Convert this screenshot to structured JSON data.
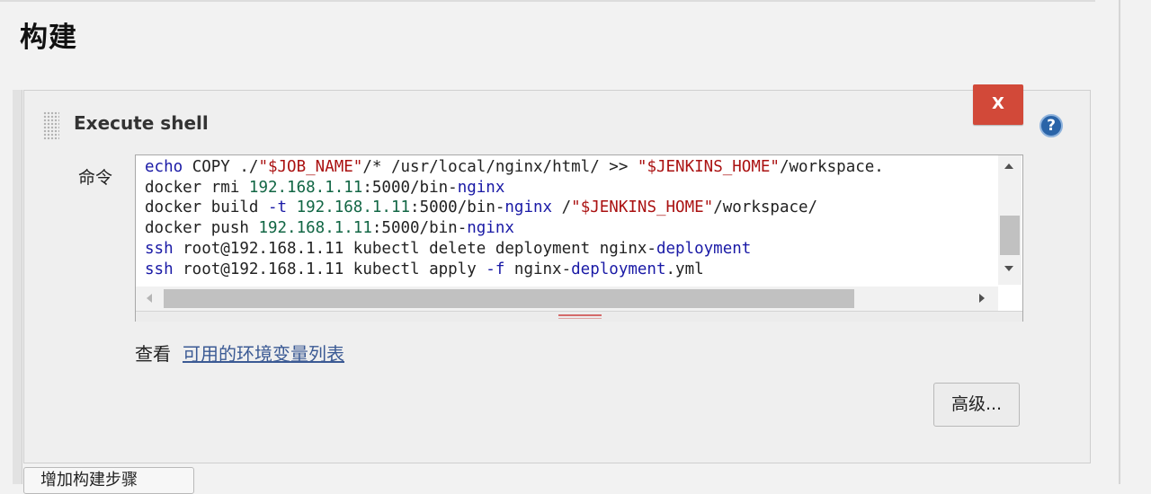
{
  "section": {
    "title": "构建"
  },
  "build_step": {
    "title": "Execute shell",
    "delete_label": "X",
    "help_label": "?",
    "command_label": "命令",
    "command_lines": [
      [
        [
          "echo",
          "cmd"
        ],
        [
          " COPY ./",
          ""
        ],
        [
          "\"$JOB_NAME\"",
          "str"
        ],
        [
          "/* /usr/local/nginx/html/ >> ",
          ""
        ],
        [
          "\"$JENKINS_HOME\"",
          "str"
        ],
        [
          "/workspace.",
          ""
        ]
      ],
      [
        [
          "docker rmi ",
          ""
        ],
        [
          "192.168.1.11",
          "num"
        ],
        [
          ":5000/bin-",
          ""
        ],
        [
          "nginx",
          "cmd"
        ]
      ],
      [
        [
          "docker build ",
          ""
        ],
        [
          "-t",
          "op"
        ],
        [
          " ",
          ""
        ],
        [
          "192.168.1.11",
          "num"
        ],
        [
          ":5000/bin-",
          ""
        ],
        [
          "nginx",
          "cmd"
        ],
        [
          " /",
          ""
        ],
        [
          "\"$JENKINS_HOME\"",
          "str"
        ],
        [
          "/workspace/",
          ""
        ]
      ],
      [
        [
          "docker push ",
          ""
        ],
        [
          "192.168.1.11",
          "num"
        ],
        [
          ":5000/bin-",
          ""
        ],
        [
          "nginx",
          "cmd"
        ]
      ],
      [
        [
          "ssh",
          "cmd"
        ],
        [
          " root@192.168.1.11 kubectl delete deployment nginx-",
          ""
        ],
        [
          "deployment",
          "cmd"
        ]
      ],
      [
        [
          "ssh",
          "cmd"
        ],
        [
          " root@192.168.1.11 kubectl apply ",
          ""
        ],
        [
          "-f",
          "op"
        ],
        [
          " nginx-",
          ""
        ],
        [
          "deployment",
          "cmd"
        ],
        [
          ".yml",
          ""
        ]
      ]
    ],
    "env_prefix": "查看",
    "env_link": "可用的环境变量列表",
    "advanced_label": "高级..."
  },
  "add_step": {
    "label": "增加构建步骤"
  },
  "colors": {
    "delete": "#d24939",
    "help": "#2a64a8",
    "link": "#3b5a94"
  }
}
